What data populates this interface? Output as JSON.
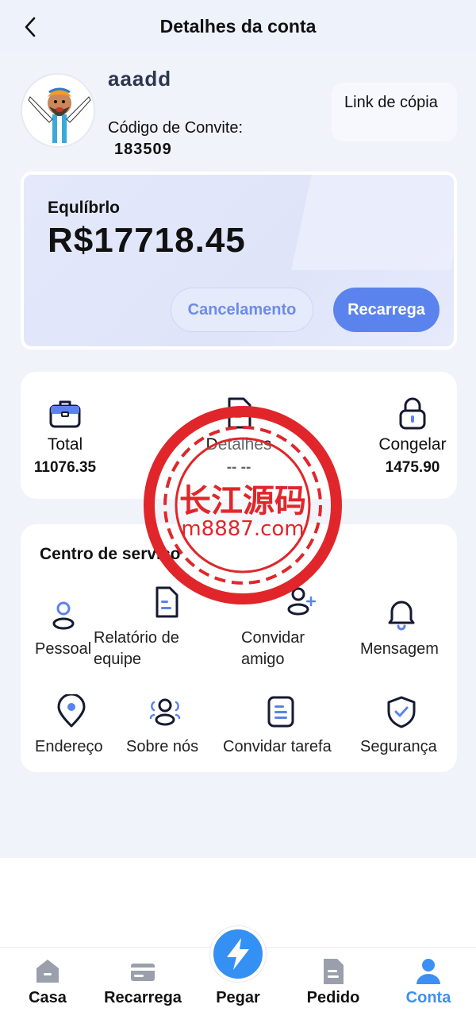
{
  "header": {
    "title": "Detalhes da conta"
  },
  "profile": {
    "username": "aaadd",
    "invite_label": "Código de Convite:",
    "invite_code": "183509",
    "copy_link": "Link de cópia"
  },
  "balance": {
    "label": "Equlíbrlo",
    "value": "R$17718.45",
    "cancel_label": "Cancelamento",
    "recharge_label": "Recarrega"
  },
  "stats": [
    {
      "label": "Total",
      "value": "11076.35",
      "icon": "briefcase-icon"
    },
    {
      "label": "Detalhes",
      "value": "-- --",
      "icon": "document-icon"
    },
    {
      "label": "Congelar",
      "value": "1475.90",
      "icon": "lock-icon"
    }
  ],
  "services": {
    "title": "Centro de serviço",
    "items": [
      {
        "label": "Pessoal",
        "icon": "user-icon"
      },
      {
        "label": "Relatório de equipe",
        "icon": "report-icon"
      },
      {
        "label": "Convidar amigo",
        "icon": "add-user-icon"
      },
      {
        "label": "Mensagem",
        "icon": "bell-icon"
      },
      {
        "label": "Endereço",
        "icon": "location-icon"
      },
      {
        "label": "Sobre nós",
        "icon": "team-icon"
      },
      {
        "label": "Convidar tarefa",
        "icon": "task-list-icon"
      },
      {
        "label": "Segurança",
        "icon": "shield-icon"
      }
    ]
  },
  "tabbar": {
    "items": [
      {
        "label": "Casa",
        "icon": "home-icon"
      },
      {
        "label": "Recarrega",
        "icon": "card-icon"
      },
      {
        "label": "Pegar",
        "icon": "lightning-icon"
      },
      {
        "label": "Pedido",
        "icon": "order-icon"
      },
      {
        "label": "Conta",
        "icon": "account-icon",
        "active": true
      }
    ]
  },
  "watermark": {
    "line1": "长江源码",
    "line2": "m8887.com"
  },
  "colors": {
    "accent": "#5b83ee",
    "active_tab": "#3e8ff4",
    "watermark": "#e0262a"
  }
}
